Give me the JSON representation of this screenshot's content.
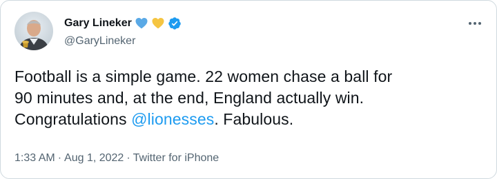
{
  "tweet": {
    "author": {
      "display_name": "Gary Lineker",
      "handle": "@GaryLineker",
      "name_emojis": [
        "blue-heart",
        "yellow-heart"
      ],
      "verified": true
    },
    "text_parts": {
      "line1": "Football is a simple game. 22 women chase a ball for",
      "line2": "90 minutes and, at the end, England actually win.",
      "line3_prefix": "Congratulations ",
      "mention": "@lionesses",
      "line3_suffix": ". Fabulous."
    },
    "meta": {
      "time": "1:33 AM",
      "separator": "·",
      "date": "Aug 1, 2022",
      "source": "Twitter for iPhone"
    }
  },
  "colors": {
    "text": "#0f1419",
    "secondary": "#536471",
    "link": "#1d9bf0",
    "border": "#cfd9de",
    "blue_heart": "#5aa9e6",
    "yellow_heart": "#f5c542"
  }
}
